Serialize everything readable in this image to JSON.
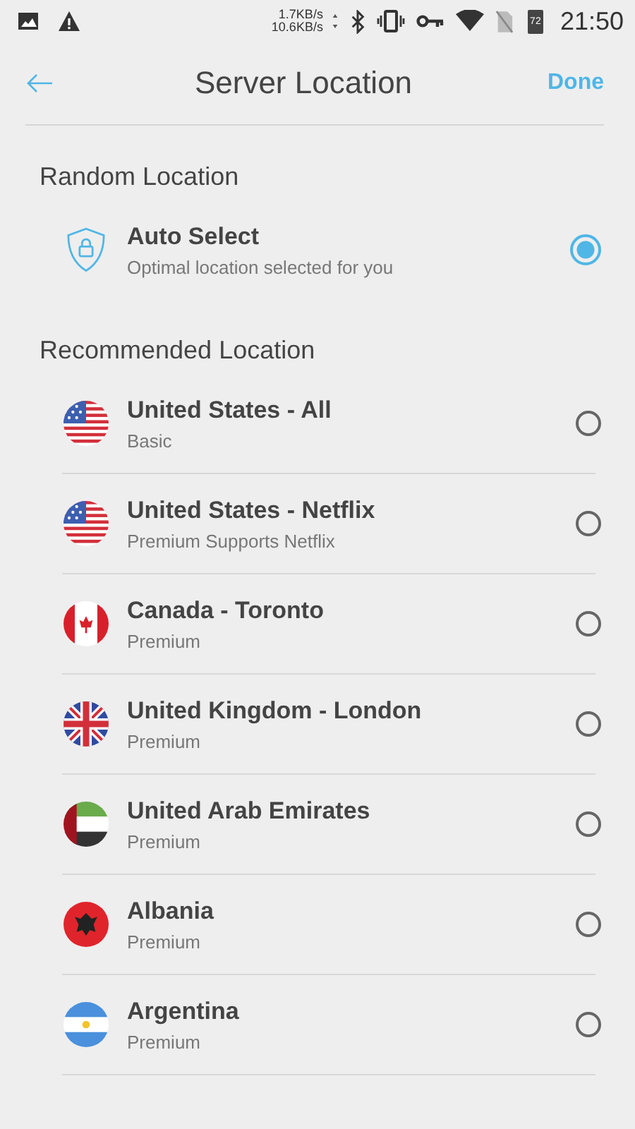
{
  "status_bar": {
    "upload": "1.7KB/s",
    "download": "10.6KB/s",
    "battery": "72",
    "time": "21:50"
  },
  "header": {
    "title": "Server Location",
    "action": "Done"
  },
  "sections": [
    {
      "title": "Random Location",
      "items": [
        {
          "kind": "shield",
          "name": "Auto Select",
          "detail": "Optimal location selected for you",
          "selected": true
        }
      ]
    },
    {
      "title": "Recommended Location",
      "items": [
        {
          "kind": "us",
          "name": "United States - All",
          "detail": "Basic",
          "selected": false
        },
        {
          "kind": "us",
          "name": "United States - Netflix",
          "detail": "Premium Supports Netflix",
          "selected": false
        },
        {
          "kind": "ca",
          "name": "Canada - Toronto",
          "detail": "Premium",
          "selected": false
        },
        {
          "kind": "gb",
          "name": "United Kingdom - London",
          "detail": "Premium",
          "selected": false
        },
        {
          "kind": "ae",
          "name": "United Arab Emirates",
          "detail": "Premium",
          "selected": false
        },
        {
          "kind": "al",
          "name": "Albania",
          "detail": "Premium",
          "selected": false
        },
        {
          "kind": "ar",
          "name": "Argentina",
          "detail": "Premium",
          "selected": false
        }
      ]
    }
  ]
}
